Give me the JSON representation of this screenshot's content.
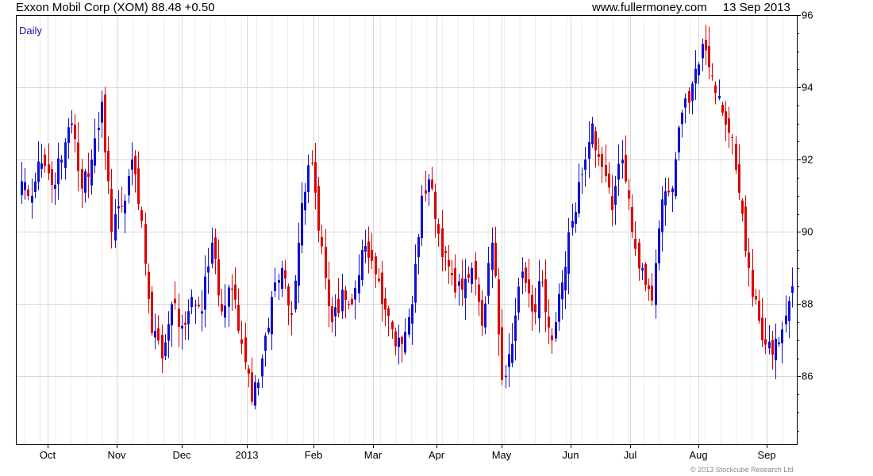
{
  "header": {
    "title": "Exxon Mobil Corp (XOM) 88.48 +0.50",
    "website": "www.fullermoney.com",
    "date": "13 Sep 2013"
  },
  "copyright": "© 2013 Stockcube Research Ltd",
  "colors": {
    "up": "#1010d0",
    "down": "#dd0000",
    "grid": "#d8d8d8",
    "frame": "#000000",
    "period_label": "#1a1aa0"
  },
  "chart_data": {
    "type": "candlestick",
    "period_label": "Daily",
    "y_axis": {
      "position": "right",
      "min": 84.1,
      "max": 96,
      "ticks": [
        86,
        88,
        90,
        92,
        94,
        96
      ]
    },
    "x_axis": {
      "labels": [
        "Oct",
        "Nov",
        "Dec",
        "2013",
        "Feb",
        "Mar",
        "Apr",
        "May",
        "Jun",
        "Jul",
        "Aug",
        "Sep"
      ]
    },
    "grid": true,
    "last": 88.48,
    "change": 0.5,
    "anchors": [
      [
        91.4,
        "u"
      ],
      [
        91.0,
        "d"
      ],
      [
        91.9,
        "u"
      ],
      [
        91.3,
        "d"
      ],
      [
        92.0,
        "u"
      ],
      [
        93.0,
        "d"
      ],
      [
        91.2,
        "d"
      ],
      [
        92.0,
        "u"
      ],
      [
        93.6,
        "u"
      ],
      [
        90.0,
        "d"
      ],
      [
        90.7,
        "u"
      ],
      [
        92.0,
        "u"
      ],
      [
        90.3,
        "d"
      ],
      [
        87.2,
        "d"
      ],
      [
        86.5,
        "d"
      ],
      [
        88.0,
        "u"
      ],
      [
        87.4,
        "d"
      ],
      [
        88.2,
        "u"
      ],
      [
        87.8,
        "d"
      ],
      [
        89.7,
        "u"
      ],
      [
        87.8,
        "d"
      ],
      [
        88.4,
        "u"
      ],
      [
        86.9,
        "d"
      ],
      [
        85.3,
        "d"
      ],
      [
        86.5,
        "u"
      ],
      [
        88.2,
        "u"
      ],
      [
        89.0,
        "u"
      ],
      [
        87.7,
        "d"
      ],
      [
        90.8,
        "u"
      ],
      [
        91.9,
        "u"
      ],
      [
        89.6,
        "d"
      ],
      [
        87.5,
        "d"
      ],
      [
        88.4,
        "u"
      ],
      [
        88.0,
        "d"
      ],
      [
        89.5,
        "u"
      ],
      [
        89.2,
        "d"
      ],
      [
        88.0,
        "d"
      ],
      [
        87.3,
        "d"
      ],
      [
        86.9,
        "d"
      ],
      [
        88.0,
        "u"
      ],
      [
        91.0,
        "u"
      ],
      [
        91.2,
        "u"
      ],
      [
        89.3,
        "d"
      ],
      [
        88.8,
        "d"
      ],
      [
        88.4,
        "d"
      ],
      [
        89.0,
        "u"
      ],
      [
        87.4,
        "d"
      ],
      [
        89.7,
        "u"
      ],
      [
        85.9,
        "d"
      ],
      [
        86.9,
        "u"
      ],
      [
        88.9,
        "u"
      ],
      [
        87.8,
        "d"
      ],
      [
        88.6,
        "u"
      ],
      [
        87.0,
        "d"
      ],
      [
        88.6,
        "u"
      ],
      [
        90.3,
        "u"
      ],
      [
        91.6,
        "u"
      ],
      [
        93.0,
        "u"
      ],
      [
        91.8,
        "d"
      ],
      [
        90.6,
        "d"
      ],
      [
        92.0,
        "u"
      ],
      [
        90.0,
        "d"
      ],
      [
        89.0,
        "d"
      ],
      [
        88.1,
        "d"
      ],
      [
        90.9,
        "u"
      ],
      [
        91.2,
        "u"
      ],
      [
        93.3,
        "u"
      ],
      [
        94.1,
        "u"
      ],
      [
        95.2,
        "u"
      ],
      [
        94.3,
        "d"
      ],
      [
        93.3,
        "d"
      ],
      [
        92.6,
        "d"
      ],
      [
        90.5,
        "d"
      ],
      [
        88.2,
        "d"
      ],
      [
        87.0,
        "d"
      ],
      [
        86.6,
        "u"
      ],
      [
        87.3,
        "u"
      ],
      [
        88.5,
        "u"
      ]
    ]
  }
}
